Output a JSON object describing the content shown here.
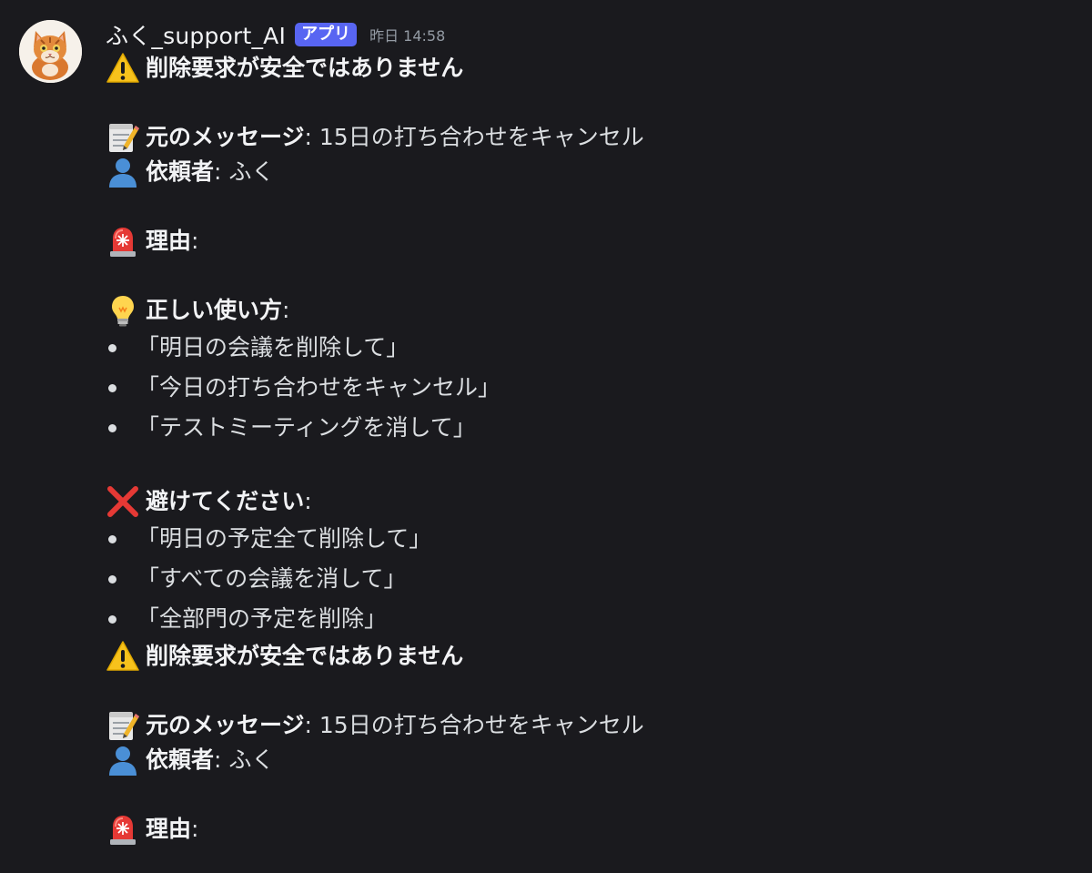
{
  "author": {
    "name": "ふく_support_AI",
    "badge": "アプリ",
    "timestamp": "昨日 14:58",
    "avatar_icon": "cat-avatar-icon"
  },
  "colors": {
    "background": "#1a1a1e",
    "badge": "#5865f2",
    "text": "#dbdee1",
    "muted": "#949ba4"
  },
  "blocks": [
    {
      "warning_title": "削除要求が安全ではありません",
      "original_label": "元のメッセージ",
      "original_value": ": 15日の打ち合わせをキャンセル",
      "requester_label": "依頼者",
      "requester_value": ": ふく",
      "reason_label": "理由",
      "reason_value": ":",
      "correct_label": "正しい使い方",
      "correct_value": ":",
      "correct_examples": [
        "「明日の会議を削除して」",
        "「今日の打ち合わせをキャンセル」",
        "「テストミーティングを消して」"
      ],
      "avoid_label": "避けてください",
      "avoid_value": ":",
      "avoid_examples": [
        "「明日の予定全て削除して」",
        "「すべての会議を消して」",
        "「全部門の予定を削除」"
      ]
    },
    {
      "warning_title": "削除要求が安全ではありません",
      "original_label": "元のメッセージ",
      "original_value": ": 15日の打ち合わせをキャンセル",
      "requester_label": "依頼者",
      "requester_value": ": ふく",
      "reason_label": "理由",
      "reason_value": ":"
    }
  ],
  "icons": {
    "warning": "warning-icon",
    "memo": "memo-icon",
    "person": "person-icon",
    "siren": "siren-icon",
    "bulb": "lightbulb-icon",
    "cross": "cross-mark-icon"
  }
}
